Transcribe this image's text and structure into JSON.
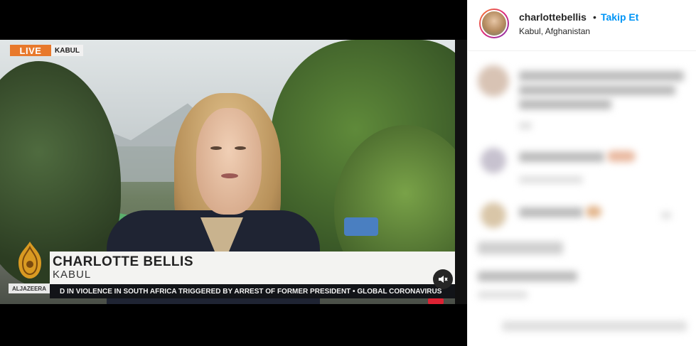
{
  "video": {
    "live_label": "LIVE",
    "live_location": "KABUL",
    "lower_third_name": "CHARLOTTE BELLIS",
    "lower_third_location": "KABUL",
    "channel_logo_text": "ALJAZEERA",
    "ticker_text": "D IN VIOLENCE IN SOUTH AFRICA TRIGGERED BY ARREST OF FORMER PRESIDENT  •  GLOBAL CORONAVIRUS",
    "mute_icon": "speaker-muted-icon"
  },
  "post_header": {
    "username": "charlottebellis",
    "separator": "•",
    "follow_label": "Takip Et",
    "location": "Kabul, Afghanistan"
  },
  "colors": {
    "accent_follow": "#0095f6",
    "live_badge": "#e8792c",
    "ticker_bg": "#121418"
  }
}
